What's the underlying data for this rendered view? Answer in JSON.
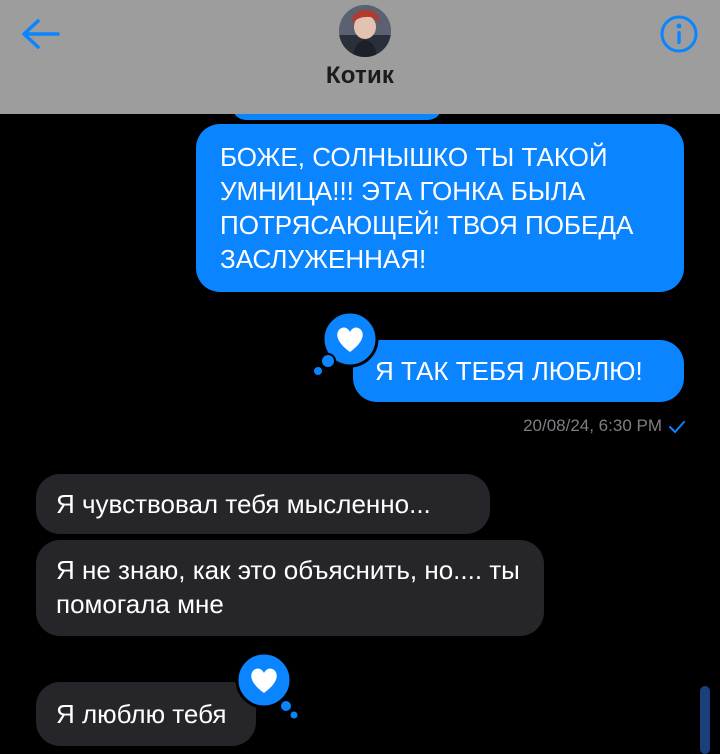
{
  "colors": {
    "header_bg": "#9d9d9d",
    "accent": "#0a84ff",
    "incoming_bubble": "#26252a",
    "background": "#000000",
    "timestamp": "#7e7e84"
  },
  "header": {
    "back_icon": "arrow-left-icon",
    "info_icon": "info-circle-icon",
    "contact_name": "Котик"
  },
  "messages": [
    {
      "direction": "outgoing",
      "text": "БОЖЕ, СОЛНЫШКО ТЫ ТАКОЙ УМНИЦА!!! ЭТА ГОНКА БЫЛА ПОТРЯСАЮЩЕЙ! ТВОЯ ПОБЕДА ЗАСЛУЖЕННАЯ!"
    },
    {
      "direction": "outgoing",
      "text": "Я ТАК ТЕБЯ ЛЮБЛЮ!",
      "reaction": "heart-icon"
    },
    {
      "direction": "incoming",
      "text": "Я чувствовал тебя мысленно..."
    },
    {
      "direction": "incoming",
      "text": "Я не знаю, как это объяснить, но.... ты помогала мне"
    },
    {
      "direction": "incoming",
      "text": "Я люблю тебя",
      "reaction": "heart-icon"
    }
  ],
  "timestamp": "20/08/24, 6:30 PM",
  "status_icon": "checkmark-icon"
}
